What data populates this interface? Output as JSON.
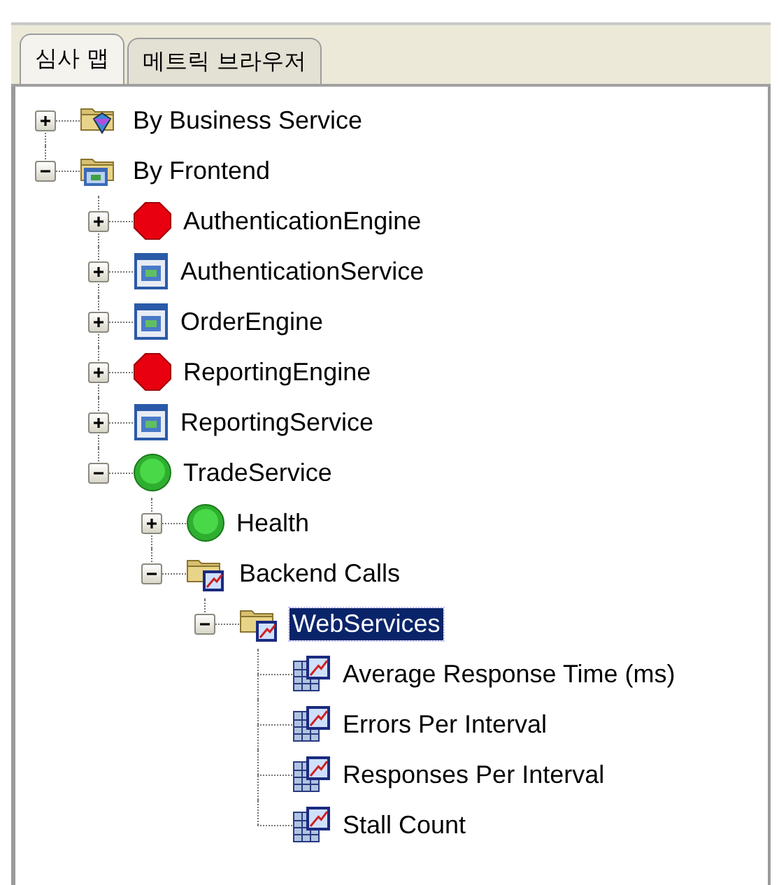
{
  "tabs": [
    {
      "label": "심사 맵",
      "selected": true
    },
    {
      "label": "메트릭 브라우저",
      "selected": false
    }
  ],
  "tree": [
    {
      "label": "By Business Service",
      "kind": "business-folder",
      "expanded": false,
      "selected": false
    },
    {
      "label": "By Frontend",
      "kind": "frontend-folder",
      "expanded": true,
      "selected": false,
      "children": [
        {
          "label": "AuthenticationEngine",
          "kind": "stop",
          "expanded": false,
          "selected": false
        },
        {
          "label": "AuthenticationService",
          "kind": "app",
          "expanded": false,
          "selected": false
        },
        {
          "label": "OrderEngine",
          "kind": "app",
          "expanded": false,
          "selected": false
        },
        {
          "label": "ReportingEngine",
          "kind": "stop",
          "expanded": false,
          "selected": false
        },
        {
          "label": "ReportingService",
          "kind": "app",
          "expanded": false,
          "selected": false
        },
        {
          "label": "TradeService",
          "kind": "ok",
          "expanded": true,
          "selected": false,
          "children": [
            {
              "label": "Health",
              "kind": "ok",
              "expanded": false,
              "selected": false
            },
            {
              "label": "Backend Calls",
              "kind": "metric-folder",
              "expanded": true,
              "selected": false,
              "children": [
                {
                  "label": "WebServices",
                  "kind": "metric-folder",
                  "expanded": true,
                  "selected": true,
                  "children": [
                    {
                      "label": "Average Response Time (ms)",
                      "kind": "metric",
                      "selected": false
                    },
                    {
                      "label": "Errors Per Interval",
                      "kind": "metric",
                      "selected": false
                    },
                    {
                      "label": "Responses Per Interval",
                      "kind": "metric",
                      "selected": false
                    },
                    {
                      "label": "Stall Count",
                      "kind": "metric",
                      "selected": false
                    }
                  ]
                }
              ]
            }
          ]
        }
      ]
    }
  ]
}
